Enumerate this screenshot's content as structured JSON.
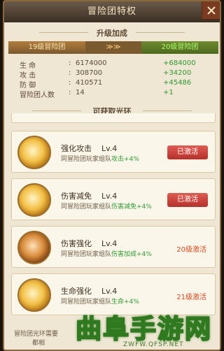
{
  "title": "冒险团特权",
  "section1": "升级加成",
  "compare": {
    "current": "19级冒险团",
    "next": "20级冒险团"
  },
  "stats": [
    {
      "label": "生 命",
      "value": "6174000",
      "delta": "+684000"
    },
    {
      "label": "攻 击",
      "value": "308700",
      "delta": "+34200"
    },
    {
      "label": "防 御",
      "value": "410571",
      "delta": "+45486"
    },
    {
      "label": "冒险团人数",
      "value": "14",
      "delta": "+1"
    }
  ],
  "section2": "可获取光环",
  "auras": [
    {
      "name": "强化攻击",
      "level": "Lv.4",
      "desc": "同冒险团玩家组队",
      "bonus": "攻击+4%",
      "status": "已激活",
      "active": true
    },
    {
      "name": "伤害减免",
      "level": "Lv.4",
      "desc": "同冒险团玩家组队",
      "bonus": "伤害减免+4%",
      "status": "已激活",
      "active": true
    },
    {
      "name": "伤害强化",
      "level": "Lv.4",
      "desc": "同冒险团玩家组队",
      "bonus": "伤害加成+4%",
      "status": "20级激活",
      "active": false
    },
    {
      "name": "生命强化",
      "level": "Lv.4",
      "desc": "同冒险团玩家组队",
      "bonus": "生命+4%",
      "status": "21级激活",
      "active": false
    }
  ],
  "footer": {
    "line1": "冒险团光环需要",
    "line2": "都相"
  },
  "watermark": {
    "main": "曲阜手游网",
    "sub": "ZWFW.QFSP.NET"
  }
}
